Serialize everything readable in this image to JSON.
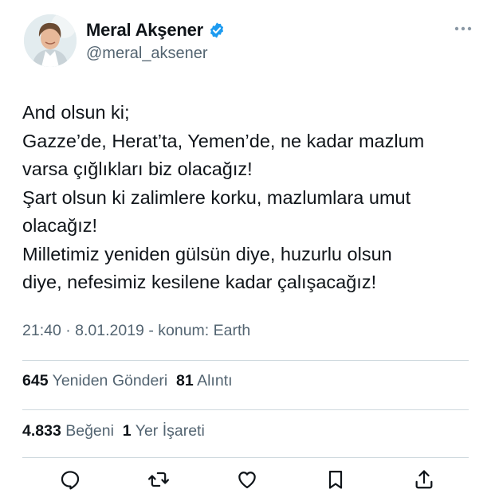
{
  "author": {
    "name": "Meral Akşener",
    "handle": "@meral_aksener",
    "verified_icon": "verified-badge-icon",
    "accent_color": "#1d9bf0"
  },
  "tweet": {
    "lines": [
      "And olsun ki;",
      "Gazze’de, Herat’ta, Yemen’de, ne kadar mazlum",
      "varsa çığlıkları biz olacağız!",
      "Şart olsun ki zalimlere korku, mazlumlara umut",
      "olacağız!",
      "Milletimiz yeniden gülsün diye, huzurlu olsun",
      "diye, nefesimiz kesilene kadar çalışacağız!"
    ],
    "time": "21:40",
    "date": "8.01.2019",
    "location": "konum: Earth",
    "separator": "·",
    "dash": "-"
  },
  "stats": {
    "retweets": "645",
    "retweets_label": "Yeniden Gönderi",
    "quotes": "81",
    "quotes_label": "Alıntı",
    "likes": "4.833",
    "likes_label": "Beğeni",
    "bookmarks": "1",
    "bookmarks_label": "Yer İşareti"
  },
  "actions": [
    "reply-icon",
    "retweet-icon",
    "like-icon",
    "bookmark-icon",
    "share-icon"
  ],
  "colors": {
    "text": "#0f1419",
    "secondary": "#536471",
    "divider": "#cfd9de"
  }
}
